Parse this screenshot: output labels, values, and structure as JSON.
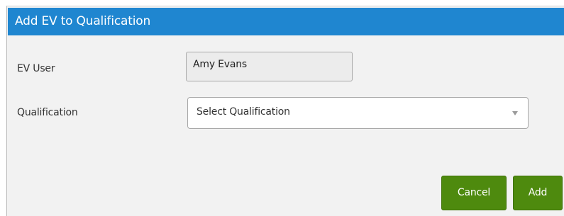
{
  "dialog": {
    "title": "Add EV to Qualification"
  },
  "form": {
    "ev_user_label": "EV User",
    "ev_user_value": "Amy Evans",
    "qualification_label": "Qualification",
    "qualification_selected": "Select Qualification"
  },
  "buttons": {
    "cancel_label": "Cancel",
    "add_label": "Add"
  },
  "colors": {
    "title_bar": "#1f86d0",
    "button_green": "#4e8a0e",
    "dialog_background": "#f2f2f2"
  },
  "icons": {
    "dropdown": "chevron-down-icon"
  }
}
